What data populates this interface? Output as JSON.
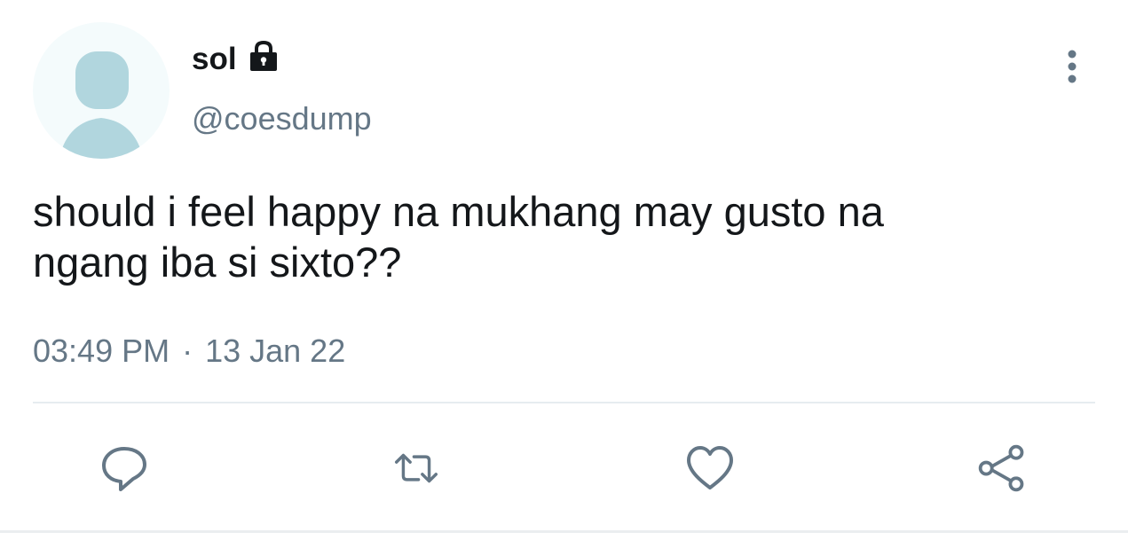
{
  "tweet": {
    "display_name": "sol",
    "protected_icon": "lock-icon",
    "handle": "@coesdump",
    "text": "should i feel happy na mukhang may gusto na\nngang iba si sixto??",
    "time": "03:49 PM",
    "separator": "·",
    "date": "13 Jan 22"
  },
  "actions": {
    "reply_icon": "speech-bubble-icon",
    "retweet_icon": "retweet-icon",
    "like_icon": "heart-icon",
    "share_icon": "share-icon",
    "more_icon": "vertical-dots-icon"
  },
  "colors": {
    "text_primary": "#14171a",
    "text_secondary": "#657786",
    "icon": "#657786",
    "avatar_bg": "#f4fbfc",
    "avatar_silhouette": "#b1d6de",
    "divider": "#e6ecf0"
  }
}
